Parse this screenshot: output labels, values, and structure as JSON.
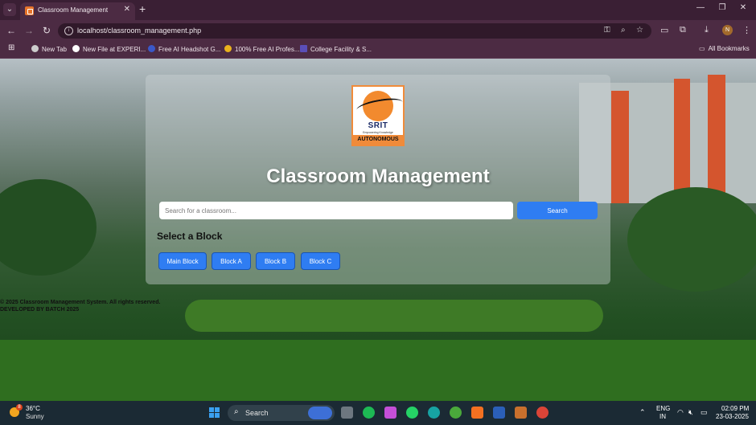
{
  "browser": {
    "tab_title": "Classroom Management",
    "tab_close": "✕",
    "new_tab": "+",
    "url": "localhost/classroom_management.php",
    "profile_initial": "N",
    "window_controls": [
      "—",
      "❐",
      "✕"
    ]
  },
  "bookmarks": {
    "items": [
      "New Tab",
      "New File at EXPERI...",
      "Free AI Headshot G...",
      "100% Free AI Profes...",
      "College Facility & S..."
    ],
    "all_label": "All Bookmarks"
  },
  "page": {
    "logo": {
      "name": "SRIT",
      "tagline": "Empowering Knowledge",
      "status": "AUTONOMOUS"
    },
    "title": "Classroom Management",
    "search": {
      "placeholder": "Search for a classroom...",
      "button_label": "Search"
    },
    "section_title": "Select a Block",
    "blocks": [
      "Main Block",
      "Block A",
      "Block B",
      "Block C"
    ],
    "footer": {
      "line1": "© 2025 Classroom Management System. All rights reserved.",
      "line2": "DEVELOPED BY BATCH 2025"
    }
  },
  "taskbar": {
    "weather_temp": "36°C",
    "weather_desc": "Sunny",
    "weather_badge": "8",
    "search_label": "Search",
    "lang_line1": "ENG",
    "lang_line2": "IN",
    "time": "02:09 PM",
    "date": "23-03-2025"
  },
  "colors": {
    "accent_blue": "#2f7df2",
    "browser_frame": "#4c2b43",
    "taskbar": "#1b2a34",
    "logo_orange": "#f28a2e"
  }
}
